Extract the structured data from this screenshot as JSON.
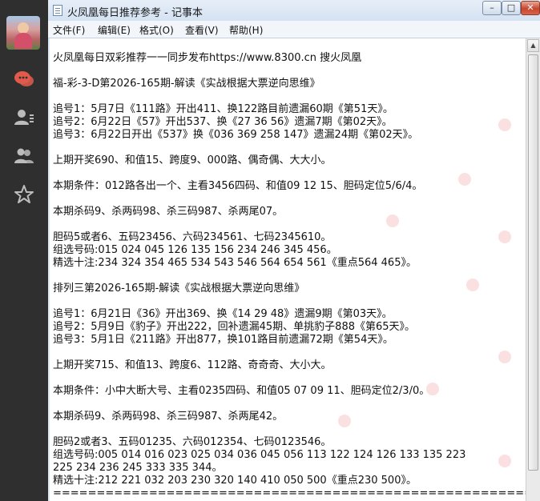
{
  "window": {
    "title": "火凤凰每日推荐参考 - 记事本",
    "minimize": "–",
    "maximize": "□",
    "close": "✕"
  },
  "menu": [
    {
      "label": "文件(F)"
    },
    {
      "label": "编辑(E)"
    },
    {
      "label": "格式(O)"
    },
    {
      "label": "查看(V)"
    },
    {
      "label": "帮助(H)"
    }
  ],
  "icons": {
    "app": "notepad-icon",
    "sidebar": [
      "chat-bubbles-icon",
      "contact-icon",
      "group-icon",
      "star-icon"
    ]
  },
  "colors": {
    "sidebar_bg": "#2f2f2f",
    "chat_icon_red": "#e15a4c",
    "icon_gray": "#bcbcbc"
  },
  "document": {
    "lines": [
      "火凤凰每日双彩推荐一一同步发布https://www.8300.cn 搜火凤凰",
      "",
      "福-彩-3-D第2026-165期-解读《实战根据大票逆向思维》",
      "",
      "追号1：5月7日《111路》开出411、换122路目前遗漏60期《第51天》。",
      "追号2：6月22日《57》开出537、换《27 36 56》遗漏7期《第02天》。",
      "追号3：6月22日开出《537》换《036 369 258 147》遗漏24期《第02天》。",
      "",
      "上期开奖690、和值15、跨度9、000路、偶奇偶、大大小。",
      "",
      "本期条件：012路各出一个、主看3456四码、和值09 12 15、胆码定位5/6/4。",
      "",
      "本期杀码9、杀两码98、杀三码987、杀两尾07。",
      "",
      "胆码5或者6、五码23456、六码234561、七码2345610。",
      "组选号码:015 024 045 126 135 156 234 246 345 456。",
      "精选十注:234 324 354 465 534 543 546 564 654 561《重点564 465》。",
      "",
      "排列三第2026-165期-解读《实战根据大票逆向思维》",
      "",
      "追号1：6月21日《36》开出369、换《14 29 48》遗漏9期《第03天》。",
      "追号2：5月9日《豹子》开出222，回补遗漏45期、单挑豹子888《第65天》。",
      "追号3：5月1日《211路》开出877，换101路目前遗漏72期《第54天》。",
      "",
      "上期开奖715、和值13、跨度6、112路、奇奇奇、大小大。",
      "",
      "本期条件：小中大断大号、主看0235四码、和值05 07 09 11、胆码定位2/3/0。",
      "",
      "本期杀码9、杀两码98、杀三码987、杀两尾42。",
      "",
      "胆码2或者3、五码01235、六码012354、七码0123546。",
      "组选号码:005 014 016 023 025 034 036 045 056 113 122 124 126 133 135 223",
      "225 234 236 245 333 335 344。",
      "精选十注:212 221 032 203 230 320 140 410 050 500《重点230 500》。",
      "=========================================================="
    ]
  }
}
